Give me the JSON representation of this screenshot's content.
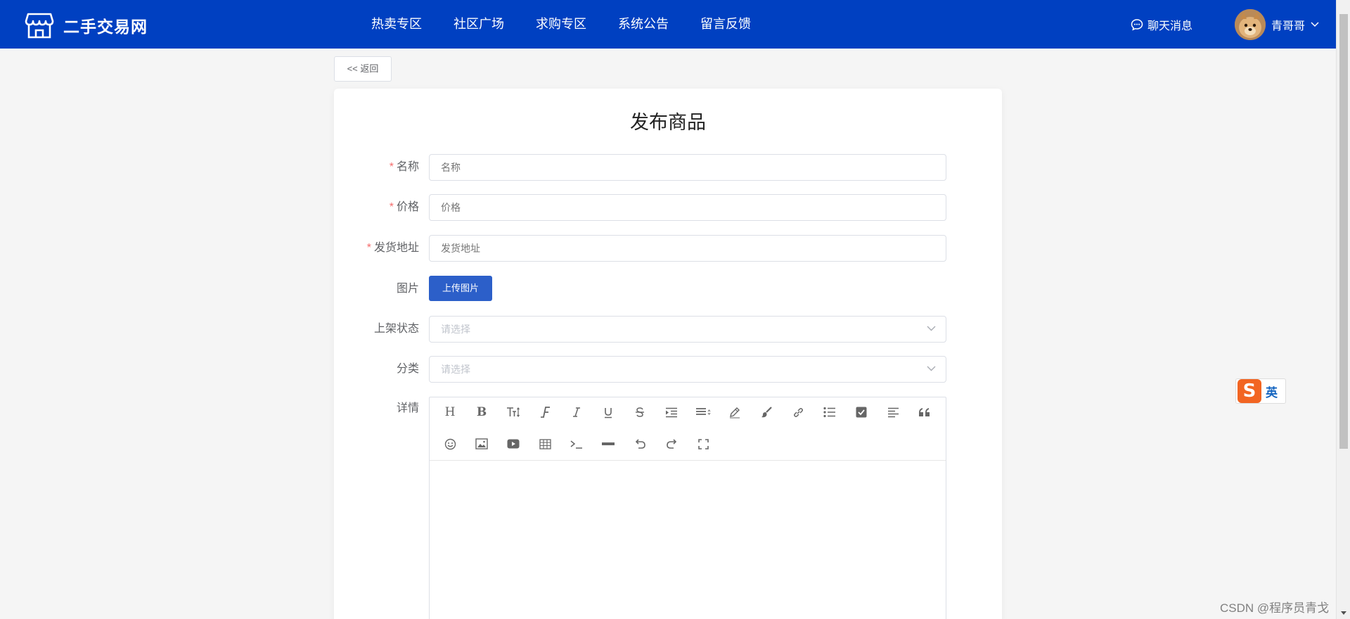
{
  "header": {
    "site_name": "二手交易网",
    "nav": [
      "热卖专区",
      "社区广场",
      "求购专区",
      "系统公告",
      "留言反馈"
    ],
    "chat_label": "聊天消息",
    "username": "青哥哥",
    "bg_color": "#0040c1"
  },
  "back_label": "<< 返回",
  "form": {
    "title": "发布商品",
    "name": {
      "label": "名称",
      "placeholder": "名称",
      "required": true
    },
    "price": {
      "label": "价格",
      "placeholder": "价格",
      "required": true
    },
    "address": {
      "label": "发货地址",
      "placeholder": "发货地址",
      "required": true
    },
    "image": {
      "label": "图片",
      "button": "上传图片"
    },
    "status": {
      "label": "上架状态",
      "placeholder": "请选择"
    },
    "category": {
      "label": "分类",
      "placeholder": "请选择"
    },
    "detail": {
      "label": "详情"
    },
    "required_mark": "*"
  },
  "editor_tools_row1": [
    "heading-icon",
    "bold-icon",
    "font-size-icon",
    "font-family-icon",
    "italic-icon",
    "underline-icon",
    "strikethrough-icon",
    "indent-icon",
    "line-height-icon",
    "text-color-icon",
    "background-color-icon",
    "link-icon",
    "bulleted-list-icon",
    "todo-icon",
    "justify-icon",
    "quote-icon"
  ],
  "editor_tools_row2": [
    "emoticon-icon",
    "image-icon",
    "video-icon",
    "table-icon",
    "code-icon",
    "divider-icon",
    "undo-icon",
    "redo-icon",
    "fullscreen-icon"
  ],
  "ime": {
    "language": "英"
  },
  "watermark": "CSDN @程序员青戈"
}
